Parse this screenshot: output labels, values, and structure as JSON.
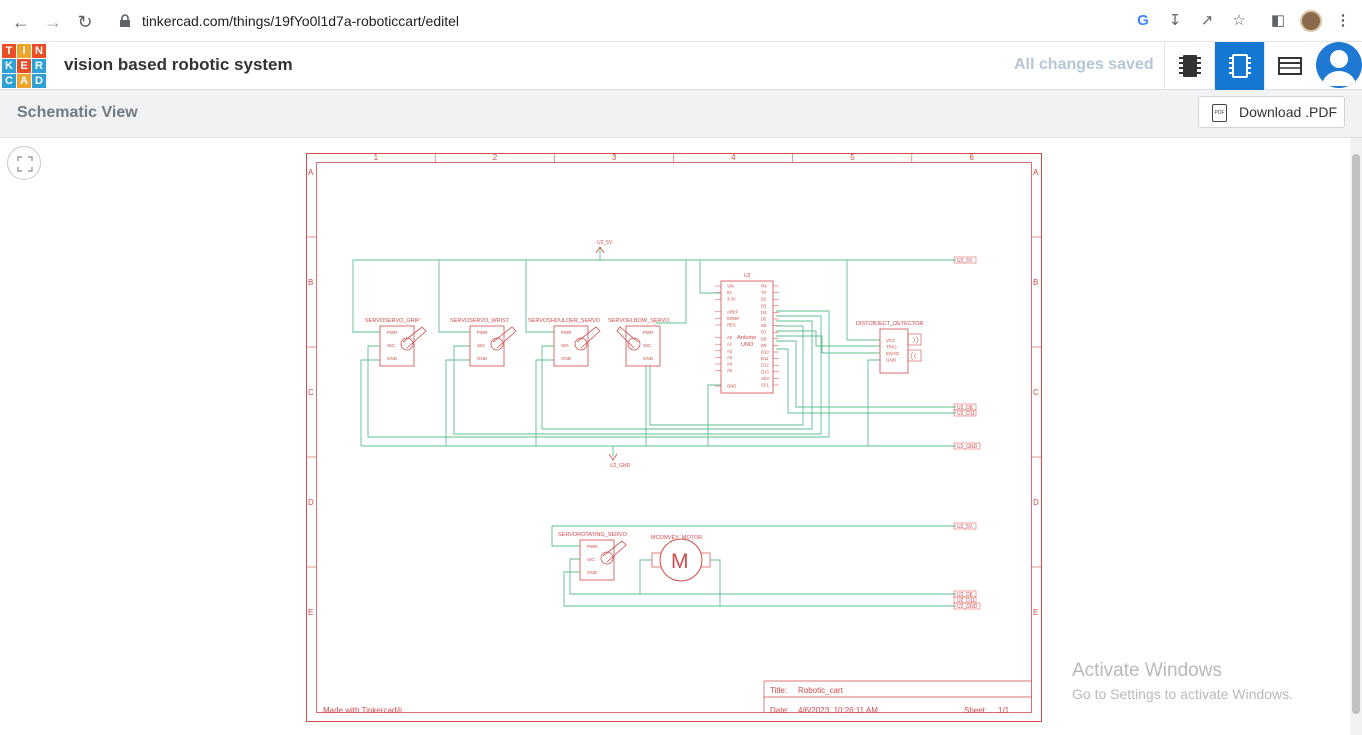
{
  "browser": {
    "url": "tinkercad.com/things/19fYo0l1d7a-roboticcart/editel"
  },
  "header": {
    "logo_letters": [
      "T",
      "I",
      "N",
      "K",
      "E",
      "R",
      "C",
      "A",
      "D"
    ],
    "project_title": "vision based robotic system",
    "save_status": "All changes saved"
  },
  "toolbar": {
    "view_title": "Schematic View",
    "download_label": "Download .PDF",
    "pdf_icon_text": "PDF"
  },
  "schematic": {
    "columns": [
      "1",
      "2",
      "3",
      "4",
      "5",
      "6"
    ],
    "rows": [
      "A",
      "B",
      "C",
      "D",
      "E"
    ],
    "net_5v": "U2_5V",
    "net_gnd": "U2_GND",
    "net_d8": "U2_D8",
    "net_d11": "U2_D11",
    "servos": [
      {
        "name": "SERVOSERVO_GRIP"
      },
      {
        "name": "SERVOSERVO_WRIST"
      },
      {
        "name": "SERVOSHOULDER_SERVO"
      },
      {
        "name": "SERVOELBOW_SERVO"
      }
    ],
    "servo_pins": [
      "PWR",
      "SIG",
      "GND"
    ],
    "arduino": {
      "ref": "U2",
      "label1": "Arduino",
      "label2": "UNO",
      "left_pins": [
        "VIN",
        "5V",
        "3.3V",
        "AREF",
        "IOREF",
        "RES",
        "A0",
        "A1",
        "A2",
        "A3",
        "A4",
        "A5",
        "GND"
      ],
      "right_pins": [
        "RX",
        "TX",
        "D2",
        "D3",
        "D4",
        "D5",
        "D6",
        "D7",
        "D8",
        "D9",
        "D10",
        "D11",
        "D12",
        "D13",
        "SDA",
        "SCL"
      ]
    },
    "sensor": {
      "name": "DISTOBJECT_DETECTOR",
      "pins": [
        "VCC",
        "TRIG",
        "ECHO",
        "GND"
      ]
    },
    "rotating_servo": "SERVOROTATING_SERVO",
    "motor": {
      "name": "MCONVEY_MOTOR",
      "symbol": "M"
    },
    "title_block": {
      "made_with": "Made with Tinkercad®",
      "title_label": "Title:",
      "title_value": "Robotic_cart",
      "date_label": "Date:",
      "date_value": "4/6/2023, 10:26:11 AM",
      "sheet_label": "Sheet:",
      "sheet_value": "1/1"
    }
  },
  "watermark": {
    "line1": "Activate Windows",
    "line2": "Go to Settings to activate Windows."
  },
  "colors": {
    "schematic_red": "#d24a4a",
    "wire_green": "#5cc08f",
    "accent_blue": "#1477d1"
  }
}
